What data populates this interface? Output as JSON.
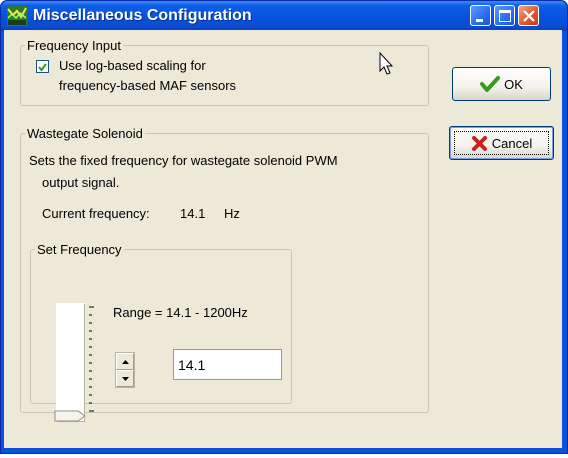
{
  "window": {
    "title": "Miscellaneous Configuration",
    "controls": {
      "minimize_icon": "minimize-icon",
      "maximize_icon": "maximize-icon",
      "close_icon": "close-icon"
    }
  },
  "frequency_input": {
    "group_label": "Frequency Input",
    "checkbox_checked": true,
    "checkbox_label_line1": "Use log-based scaling for",
    "checkbox_label_line2": "frequency-based MAF sensors"
  },
  "wastegate": {
    "group_label": "Wastegate Solenoid",
    "description_line1": "Sets the fixed frequency for wastegate solenoid PWM",
    "description_line2": "output signal.",
    "current_label": "Current frequency:",
    "current_value": "14.1",
    "current_unit": "Hz",
    "set_frequency": {
      "group_label": "Set Frequency",
      "range_text": "Range = 14.1 - 1200Hz",
      "input_value": "14.1",
      "slider_level_fraction": 0.0
    }
  },
  "buttons": {
    "ok_label": "OK",
    "cancel_label": "Cancel"
  },
  "colors": {
    "titlebar": "#0553de",
    "client_bg": "#ece9d8",
    "ok_check": "#3a9a1c",
    "cancel_x": "#c4241a"
  }
}
